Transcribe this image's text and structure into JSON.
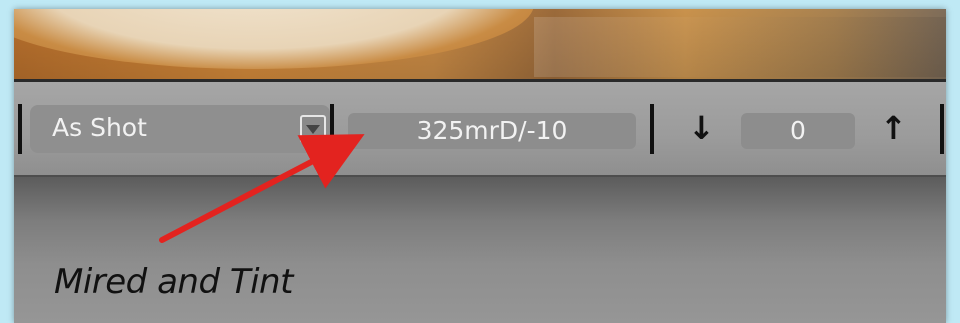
{
  "white_balance": {
    "preset_label": "As Shot",
    "dropdown_icon": "triangle-down-icon"
  },
  "temperature_tint": {
    "value": "325mrD/-10"
  },
  "exposure_step": {
    "down_icon": "arrow-down-icon",
    "value": "0",
    "up_icon": "arrow-up-icon"
  },
  "annotation": {
    "caption": "Mired and Tint",
    "arrow_color": "#e3231f"
  },
  "colors": {
    "toolbar": "#a3a3a3",
    "field": "#8d8d8d",
    "text": "#f2f2f2",
    "separator": "#111111"
  }
}
